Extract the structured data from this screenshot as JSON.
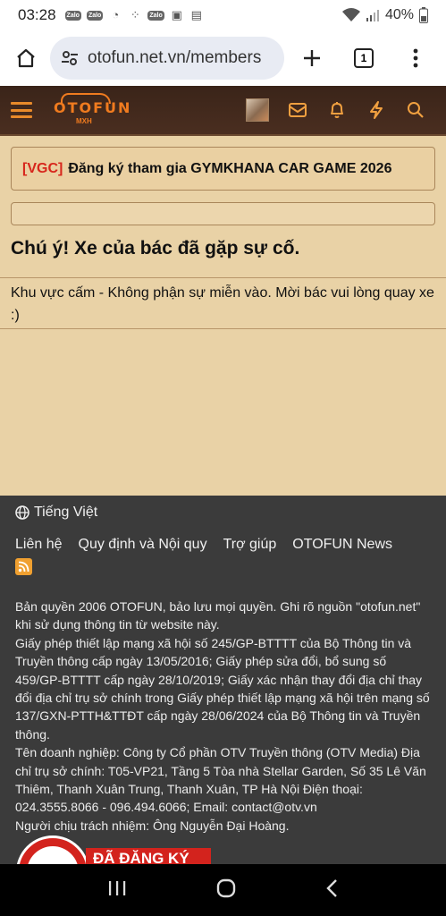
{
  "statusbar": {
    "time": "03:28",
    "battery": "40%",
    "app_icons": [
      "Zalo",
      "Zalo",
      "Zalo"
    ]
  },
  "browser": {
    "url": "otofun.net.vn/members",
    "tab_count": "1"
  },
  "site": {
    "logo_text": "OTOFUN",
    "logo_sub": "MXH"
  },
  "notice": {
    "tag": "[VGC]",
    "text": "Đăng ký tham gia GYMKHANA CAR GAME 2026"
  },
  "error": {
    "title": "Chú ý! Xe của bác đã gặp sự cố.",
    "message": "Khu vực cấm - Không phận sự miễn vào. Mời bác vui lòng quay xe :)"
  },
  "footer": {
    "language": "Tiếng Việt",
    "links": [
      "Liên hệ",
      "Quy định và Nội quy",
      "Trợ giúp",
      "OTOFUN News"
    ],
    "copyright_lines": [
      "Bản quyền 2006 OTOFUN, bảo lưu mọi quyền. Ghi rõ nguồn \"otofun.net\" khi sử dụng thông tin từ website này.",
      "Giấy phép thiết lập mạng xã hội số 245/GP-BTTTT của Bộ Thông tin và Truyền thông cấp ngày 13/05/2016; Giấy phép sửa đổi, bổ sung số 459/GP-BTTTT cấp ngày 28/10/2019; Giấy xác nhận thay đổi địa chỉ thay đổi địa chỉ trụ sở chính trong Giấy phép thiết lập mạng xã hội trên mạng số 137/GXN-PTTH&TTĐT cấp ngày 28/06/2024 của Bộ Thông tin và Truyền thông.",
      "Tên doanh nghiệp: Công ty Cổ phần OTV Truyền thông (OTV Media) Địa chỉ trụ sở chính: T05-VP21, Tầng 5 Tòa nhà Stellar Garden, Số 35 Lê Văn Thiêm, Thanh Xuân Trung, Thanh Xuân, TP Hà Nội Điện thoại: 024.3555.8066 - 096.494.6066; Email: contact@otv.vn",
      "Người chịu trách nhiệm: Ông Nguyễn Đại Hoàng."
    ],
    "badge_text": "ĐÃ ĐĂNG KÝ"
  }
}
